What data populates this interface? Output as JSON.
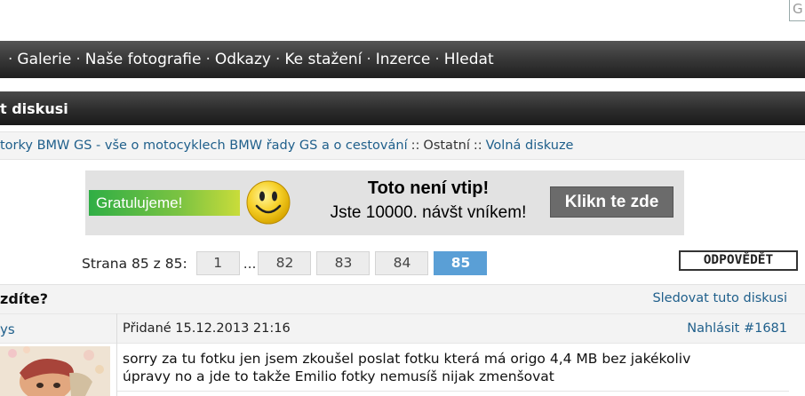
{
  "search": {
    "glyph": "G"
  },
  "nav": {
    "items": [
      "Galerie",
      "Naše fotografie",
      "Odkazy",
      "Ke stažení",
      "Inzerce",
      "Hledat"
    ],
    "separator": "·"
  },
  "section": {
    "title": "t diskusi"
  },
  "breadcrumb": {
    "forum_link": "torky BMW GS - vše o motocyklech BMW řady GS a o cestování",
    "sep": "::",
    "category": "Ostatní",
    "subforum_link": "Volná diskuze"
  },
  "banner": {
    "congrats": "Gratulujeme!",
    "title": "Toto není vtip!",
    "subtitle": "Jste 10000. návšt vníkem!",
    "button": "Klikn te zde",
    "colors": {
      "background": "#e2e2e2",
      "button": "#6b6b6b",
      "green_start": "#2fae45",
      "green_end": "#c9dc3a",
      "smiley": "#f7d12a"
    }
  },
  "pager": {
    "label": "Strana 85 z 85:",
    "first": "1",
    "dots": "...",
    "pages": [
      "82",
      "83",
      "84"
    ],
    "current": "85"
  },
  "reply_button": "ODPOVĚDĚT",
  "thread": {
    "title": "zdíte?",
    "follow": "Sledovat tuto diskusi"
  },
  "post": {
    "author": "ys",
    "date": "Přidané 15.12.2013 21:16",
    "report": "Nahlásit #1681",
    "body_line1": "sorry za tu fotku jen jsem zkoušel poslat fotku která má origo 4,4 MB bez jakékoliv",
    "body_line2": "úpravy no a jde to takže Emilio fotky nemusíš nijak zmenšovat"
  },
  "colors": {
    "link": "#1f5f8b",
    "active_page": "#5a9fd6",
    "navbar": "#2c2c2c"
  }
}
